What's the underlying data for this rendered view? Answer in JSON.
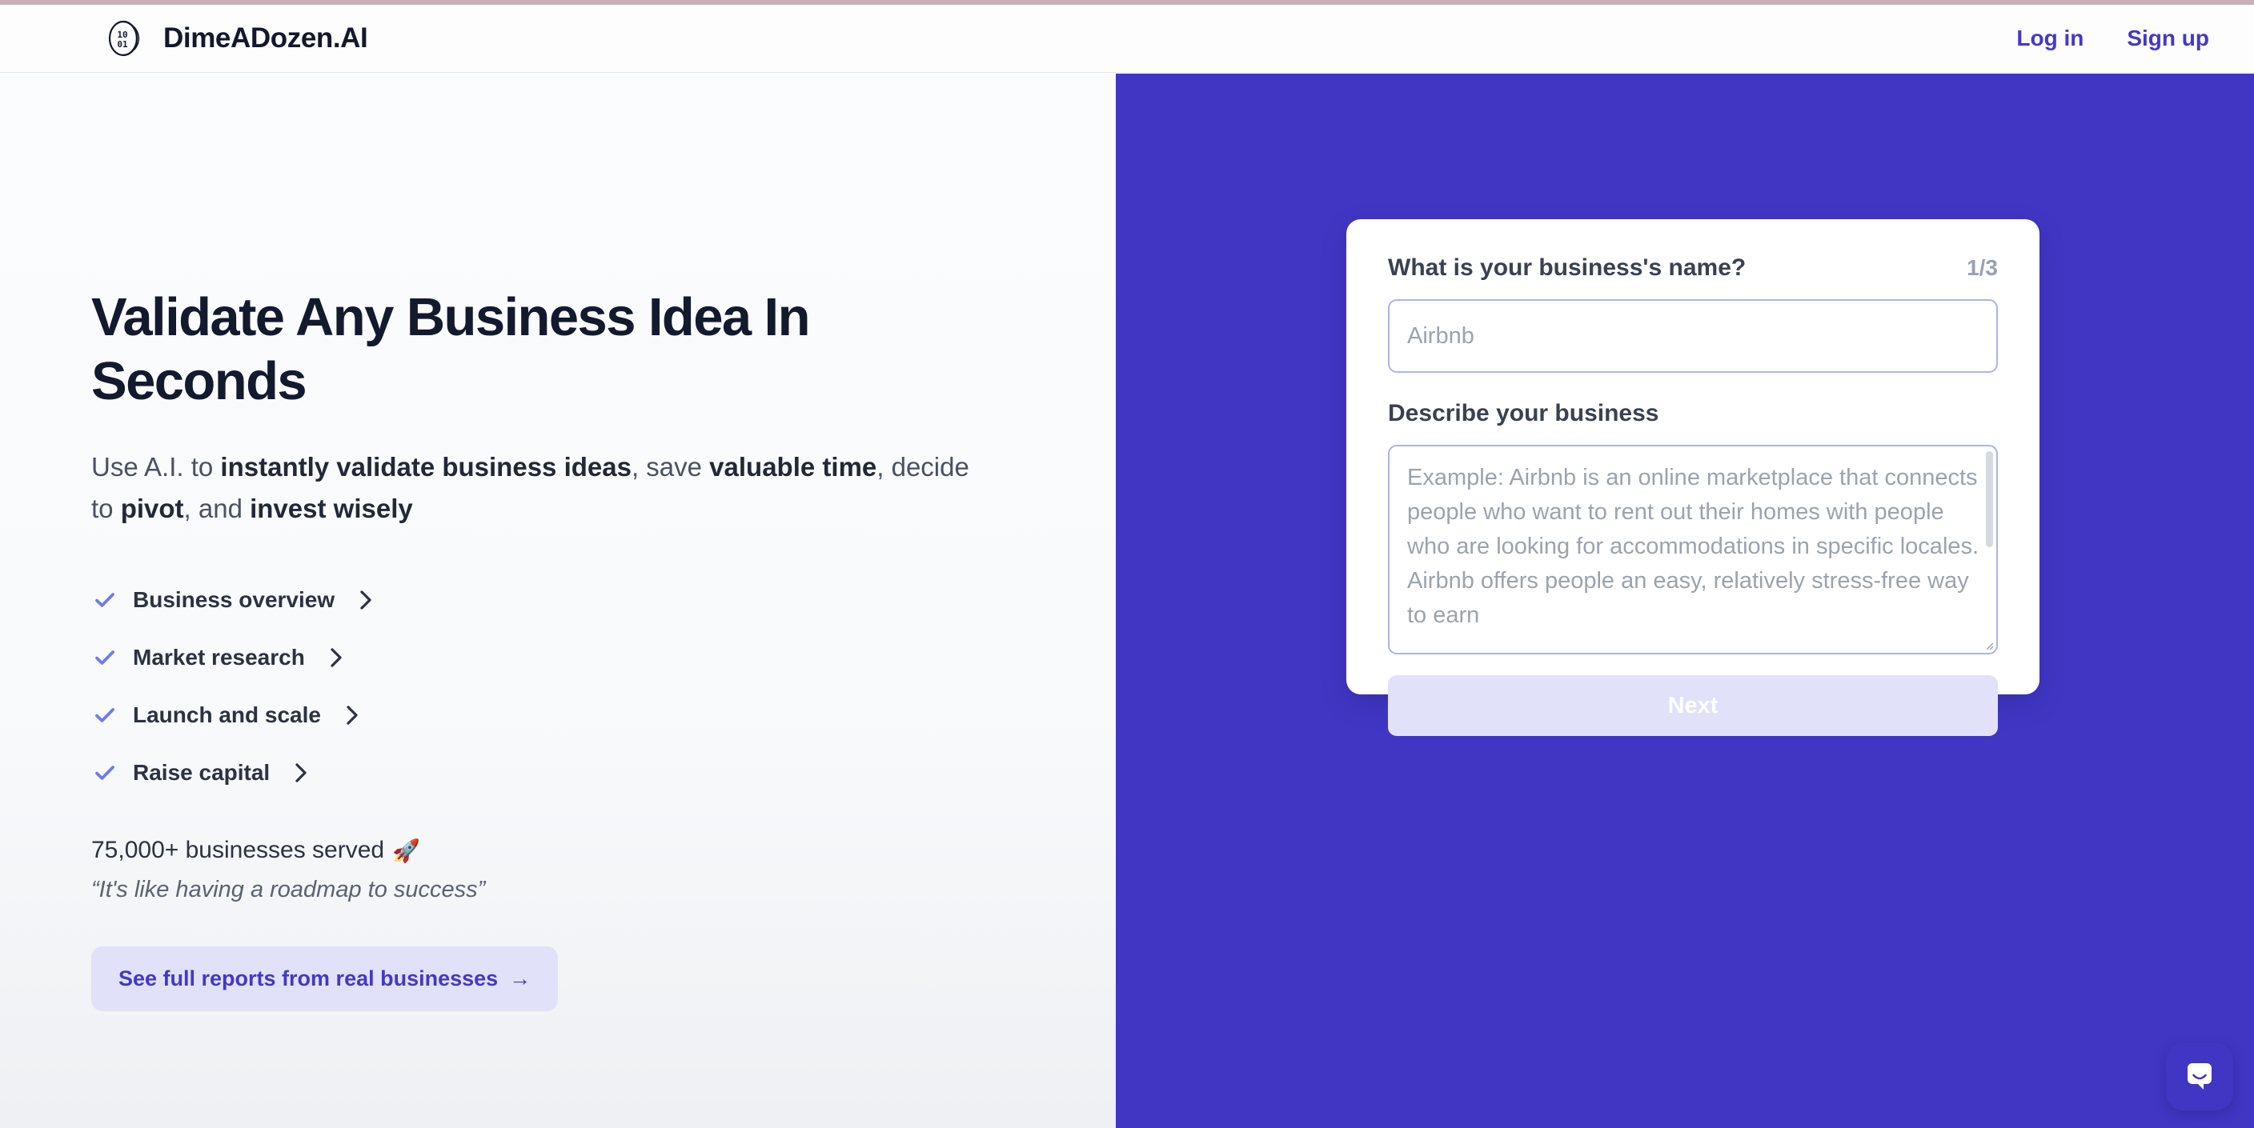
{
  "colors": {
    "brand_purple": "#4136c4",
    "accent_indigo": "#4338ca",
    "panel_light": "#f8fafc",
    "lavender_fill": "#e1e1f9",
    "input_border": "#a9b4ee",
    "top_strip": "#c9aeb8"
  },
  "header": {
    "logo_icon": "coin-logo-icon",
    "logo_digits_top": "10",
    "logo_digits_bottom": "01",
    "brand_name": "DimeADozen.AI",
    "nav": [
      {
        "label": "Log in",
        "name": "login-link"
      },
      {
        "label": "Sign up",
        "name": "signup-link"
      }
    ]
  },
  "hero": {
    "headline": "Validate Any Business Idea In Seconds",
    "subhead": {
      "part1": "Use A.I. to ",
      "bold1": "instantly validate business ideas",
      "part2": ", save ",
      "bold2": "valuable time",
      "part3": ", decide to ",
      "bold3": "pivot",
      "part4": ", and ",
      "bold4": "invest wisely"
    },
    "features": [
      {
        "label": "Business overview",
        "check_icon": "check-icon",
        "chevron_icon": "chevron-right-icon"
      },
      {
        "label": "Market research",
        "check_icon": "check-icon",
        "chevron_icon": "chevron-right-icon"
      },
      {
        "label": "Launch and scale",
        "check_icon": "check-icon",
        "chevron_icon": "chevron-right-icon"
      },
      {
        "label": "Raise capital",
        "check_icon": "check-icon",
        "chevron_icon": "chevron-right-icon"
      }
    ],
    "served_text": "75,000+ businesses served",
    "served_emoji": "🚀",
    "testimonial": "“It's like having a roadmap to success”",
    "cta_label": "See full reports from real businesses",
    "cta_arrow": "→"
  },
  "form": {
    "question": "What is your business's name?",
    "step": "1/3",
    "name_input": {
      "value": "",
      "placeholder": "Airbnb"
    },
    "describe_label": "Describe your business",
    "describe_input": {
      "value": "",
      "placeholder": "Example: Airbnb is an online marketplace that connects people who want to rent out their homes with people who are looking for accommodations in specific locales. Airbnb offers people an easy, relatively stress-free way to earn"
    },
    "next_label": "Next"
  },
  "chat": {
    "icon": "chat-bubble-smile-icon"
  }
}
